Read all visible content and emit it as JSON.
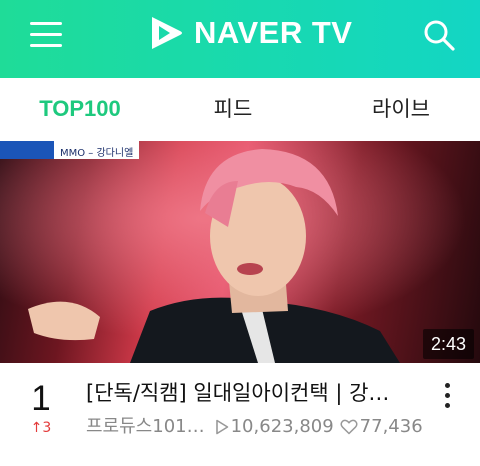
{
  "header": {
    "logo_text": "NAVER TV",
    "background_colors": [
      "#1fdc98",
      "#13d6c4"
    ]
  },
  "tabs": [
    {
      "label": "TOP100",
      "active": true
    },
    {
      "label": "피드",
      "active": false
    },
    {
      "label": "라이브",
      "active": false
    }
  ],
  "video": {
    "thumbnail_overlay_text": "MMO – 강다니엘",
    "duration": "2:43",
    "rank": "1",
    "rank_change": "↑3",
    "title": "[단독/직캠] 일대일아이컨택 | 강…",
    "channel": "프로듀스101…",
    "views": "10,623,809",
    "likes": "77,436"
  },
  "colors": {
    "accent": "#1ec97e",
    "rank_up": "#e33a3a",
    "meta_text": "#888888"
  },
  "icons": {
    "menu": "hamburger-menu-icon",
    "logo": "naver-tv-play-icon",
    "search": "search-icon",
    "views": "play-triangle-icon",
    "likes": "heart-icon",
    "more": "more-vertical-icon"
  }
}
